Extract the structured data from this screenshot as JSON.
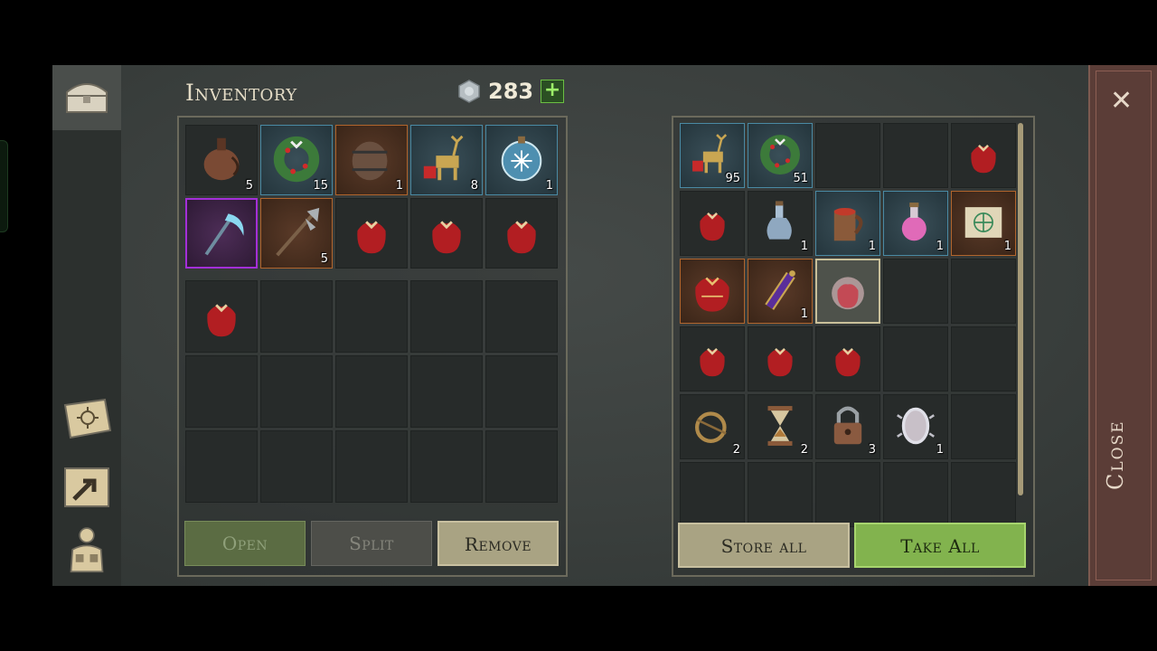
{
  "header": {
    "title": "Inventory",
    "currency_value": "283",
    "plus_label": "+"
  },
  "inventory": {
    "top_items": [
      {
        "name": "flask",
        "count": "5",
        "rarity": "none"
      },
      {
        "name": "holly-wreath",
        "count": "15",
        "rarity": "blue"
      },
      {
        "name": "barrel",
        "count": "1",
        "rarity": "orange"
      },
      {
        "name": "reindeer-figure",
        "count": "8",
        "rarity": "blue"
      },
      {
        "name": "snow-globe",
        "count": "1",
        "rarity": "blue"
      },
      {
        "name": "ice-scythe",
        "count": "",
        "rarity": "purple"
      },
      {
        "name": "halberd",
        "count": "5",
        "rarity": "orange"
      },
      {
        "name": "gift-sack",
        "count": "",
        "rarity": "none"
      },
      {
        "name": "gift-sack",
        "count": "",
        "rarity": "none"
      },
      {
        "name": "gift-sack",
        "count": "",
        "rarity": "none"
      }
    ],
    "bottom_items": [
      {
        "name": "gift-sack",
        "count": "",
        "rarity": "none"
      },
      {
        "name": "",
        "count": ""
      },
      {
        "name": "",
        "count": ""
      },
      {
        "name": "",
        "count": ""
      },
      {
        "name": "",
        "count": ""
      },
      {
        "name": "",
        "count": ""
      },
      {
        "name": "",
        "count": ""
      },
      {
        "name": "",
        "count": ""
      },
      {
        "name": "",
        "count": ""
      },
      {
        "name": "",
        "count": ""
      },
      {
        "name": "",
        "count": ""
      },
      {
        "name": "",
        "count": ""
      },
      {
        "name": "",
        "count": ""
      },
      {
        "name": "",
        "count": ""
      },
      {
        "name": "",
        "count": ""
      }
    ],
    "buttons": {
      "open": "Open",
      "split": "Split",
      "remove": "Remove"
    }
  },
  "storage": {
    "items": [
      {
        "name": "reindeer-figure",
        "count": "95",
        "rarity": "blue"
      },
      {
        "name": "holly-wreath",
        "count": "51",
        "rarity": "blue"
      },
      {
        "name": "",
        "count": ""
      },
      {
        "name": "",
        "count": ""
      },
      {
        "name": "gift-sack",
        "count": "",
        "rarity": "none"
      },
      {
        "name": "gift-sack",
        "count": "",
        "rarity": "none"
      },
      {
        "name": "potion-bottle",
        "count": "1",
        "rarity": "none"
      },
      {
        "name": "wooden-mug",
        "count": "1",
        "rarity": "blue"
      },
      {
        "name": "pink-potion",
        "count": "1",
        "rarity": "blue"
      },
      {
        "name": "rune-scroll",
        "count": "1",
        "rarity": "orange"
      },
      {
        "name": "large-gift-sack",
        "count": "",
        "rarity": "orange"
      },
      {
        "name": "magic-elixir",
        "count": "1",
        "rarity": "orange"
      },
      {
        "name": "glowing-sack",
        "count": "",
        "rarity": "selected"
      },
      {
        "name": "",
        "count": ""
      },
      {
        "name": "",
        "count": ""
      },
      {
        "name": "gift-sack",
        "count": "",
        "rarity": "none"
      },
      {
        "name": "gift-sack",
        "count": "",
        "rarity": "none"
      },
      {
        "name": "gift-sack",
        "count": "",
        "rarity": "none"
      },
      {
        "name": "",
        "count": ""
      },
      {
        "name": "",
        "count": ""
      },
      {
        "name": "ring-brooch",
        "count": "2",
        "rarity": "none"
      },
      {
        "name": "hourglass",
        "count": "2",
        "rarity": "none"
      },
      {
        "name": "padlock",
        "count": "3",
        "rarity": "none"
      },
      {
        "name": "mirror",
        "count": "1",
        "rarity": "none"
      },
      {
        "name": "",
        "count": ""
      },
      {
        "name": "",
        "count": ""
      },
      {
        "name": "",
        "count": ""
      },
      {
        "name": "",
        "count": ""
      },
      {
        "name": "",
        "count": ""
      },
      {
        "name": "",
        "count": ""
      }
    ],
    "buttons": {
      "store_all": "Store all",
      "take_all": "Take All"
    }
  },
  "close_label": "Close",
  "colors": {
    "blue_border": "#4a8aa4",
    "orange_border": "#b1652d",
    "purple_border": "#a32fd8",
    "green_button": "#82b34e"
  }
}
